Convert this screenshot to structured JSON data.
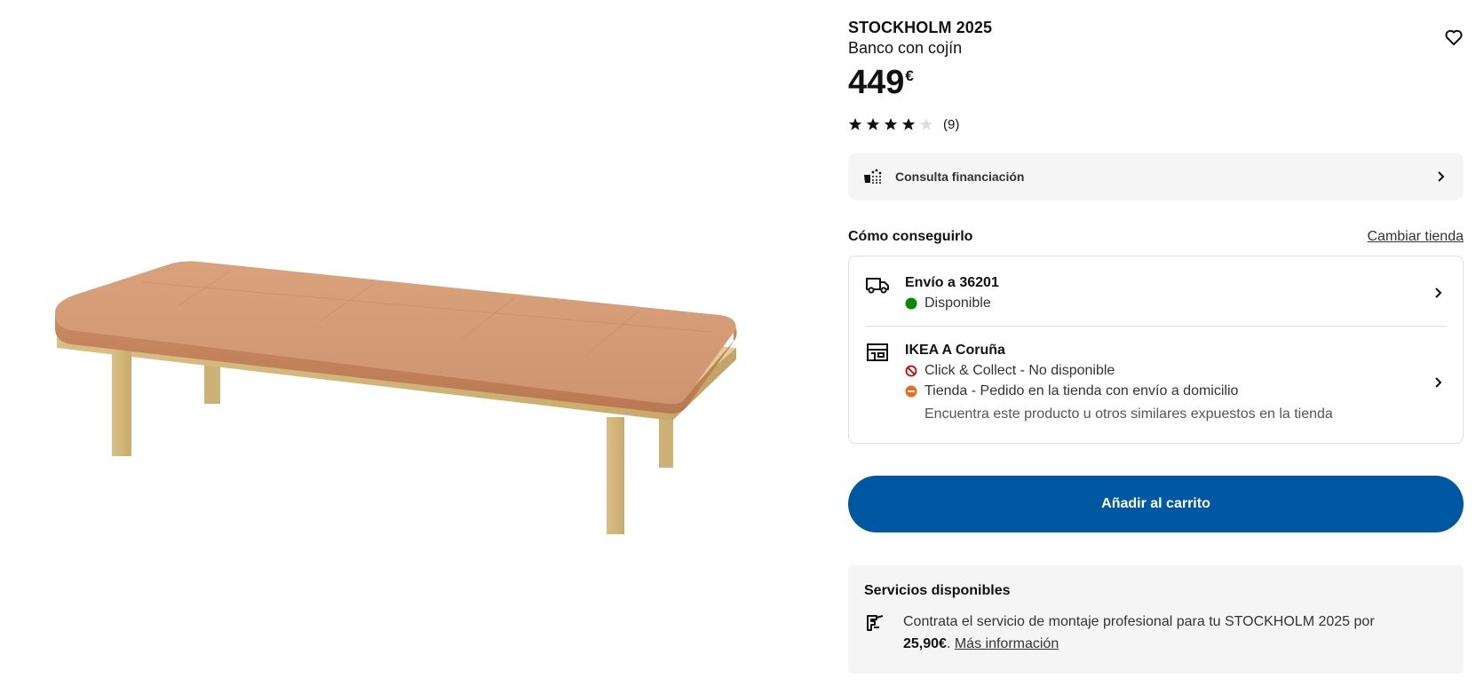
{
  "product": {
    "name": "STOCKHOLM 2025",
    "description": "Banco con cojín",
    "price": "449",
    "currency": "€",
    "rating": 4,
    "rating_max": 5,
    "rating_count": "(9)"
  },
  "finance": {
    "label": "Consulta financiación"
  },
  "availability": {
    "title": "Cómo conseguirlo",
    "change_store": "Cambiar tienda",
    "delivery": {
      "title": "Envío a 36201",
      "status": "Disponible",
      "status_color": "#0a8a00"
    },
    "store": {
      "title": "IKEA A Coruña",
      "click_collect": "Click & Collect - No disponible",
      "store_order": "Tienda - Pedido en la tienda con envío a domicilio",
      "note": "Encuentra este producto u otros similares expuestos en la tienda"
    }
  },
  "cart_button": "Añadir al carrito",
  "services": {
    "title": "Servicios disponibles",
    "text": "Contrata el servicio de montaje profesional para tu STOCKHOLM 2025 por",
    "price": "25,90€",
    "separator": ".",
    "link": "Más información"
  },
  "colors": {
    "primary": "#0058a3",
    "available": "#0a8a00",
    "unavailable": "#cc0008",
    "partial": "#f26a1b",
    "panel_bg": "#f5f5f5"
  },
  "icons": {
    "favorite": "heart-icon",
    "finance": "finance-icon",
    "delivery": "truck-icon",
    "store": "store-icon",
    "chevron": "chevron-right-icon",
    "services": "assembly-icon"
  }
}
